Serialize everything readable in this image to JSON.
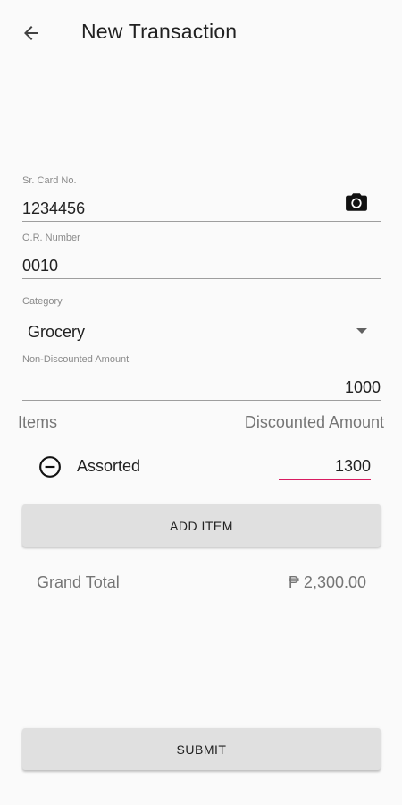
{
  "app_bar": {
    "back_icon": "arrow-left-icon",
    "title": "New Transaction"
  },
  "form": {
    "sr_card": {
      "label": "Sr. Card No.",
      "value": "1234456",
      "action_icon": "camera-icon"
    },
    "or_number": {
      "label": "O.R. Number",
      "value": "0010"
    },
    "category": {
      "label": "Category",
      "selected": "Grocery",
      "icon": "dropdown-arrow-icon"
    },
    "non_discounted": {
      "label": "Non-Discounted Amount",
      "value": "1000"
    }
  },
  "items_section": {
    "items_header": "Items",
    "amount_header": "Discounted Amount",
    "items": [
      {
        "name": "Assorted",
        "amount": "1300",
        "remove_icon": "remove-circle-icon"
      }
    ]
  },
  "add_item_label": "ADD ITEM",
  "grand_total": {
    "label": "Grand Total",
    "value": "₱ 2,300.00"
  },
  "submit_label": "SUBMIT",
  "colors": {
    "background": "#fafafa",
    "accent": "#d81b60",
    "button": "#e0e0e0"
  }
}
